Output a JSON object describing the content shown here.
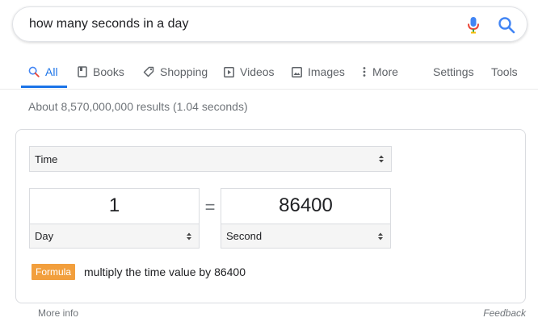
{
  "search": {
    "query": "how many seconds in a day"
  },
  "tabs": [
    {
      "label": "All",
      "icon": "search-icon",
      "active": true
    },
    {
      "label": "Books",
      "icon": "book-icon"
    },
    {
      "label": "Shopping",
      "icon": "tag-icon"
    },
    {
      "label": "Videos",
      "icon": "play-icon"
    },
    {
      "label": "Images",
      "icon": "image-icon"
    },
    {
      "label": "More",
      "icon": "more-vert-icon"
    },
    {
      "label": "Settings"
    },
    {
      "label": "Tools"
    }
  ],
  "result_stats": "About 8,570,000,000 results (1.04 seconds)",
  "converter": {
    "unit_type": "Time",
    "left": {
      "value": "1",
      "unit": "Day"
    },
    "equals": "=",
    "right": {
      "value": "86400",
      "unit": "Second"
    },
    "formula_label": "Formula",
    "formula_text": "multiply the time value by 86400"
  },
  "footer": {
    "more_info": "More info",
    "feedback": "Feedback"
  },
  "colors": {
    "accent": "#1a73e8",
    "formula_badge": "#f29f3d",
    "muted": "#70757a"
  }
}
